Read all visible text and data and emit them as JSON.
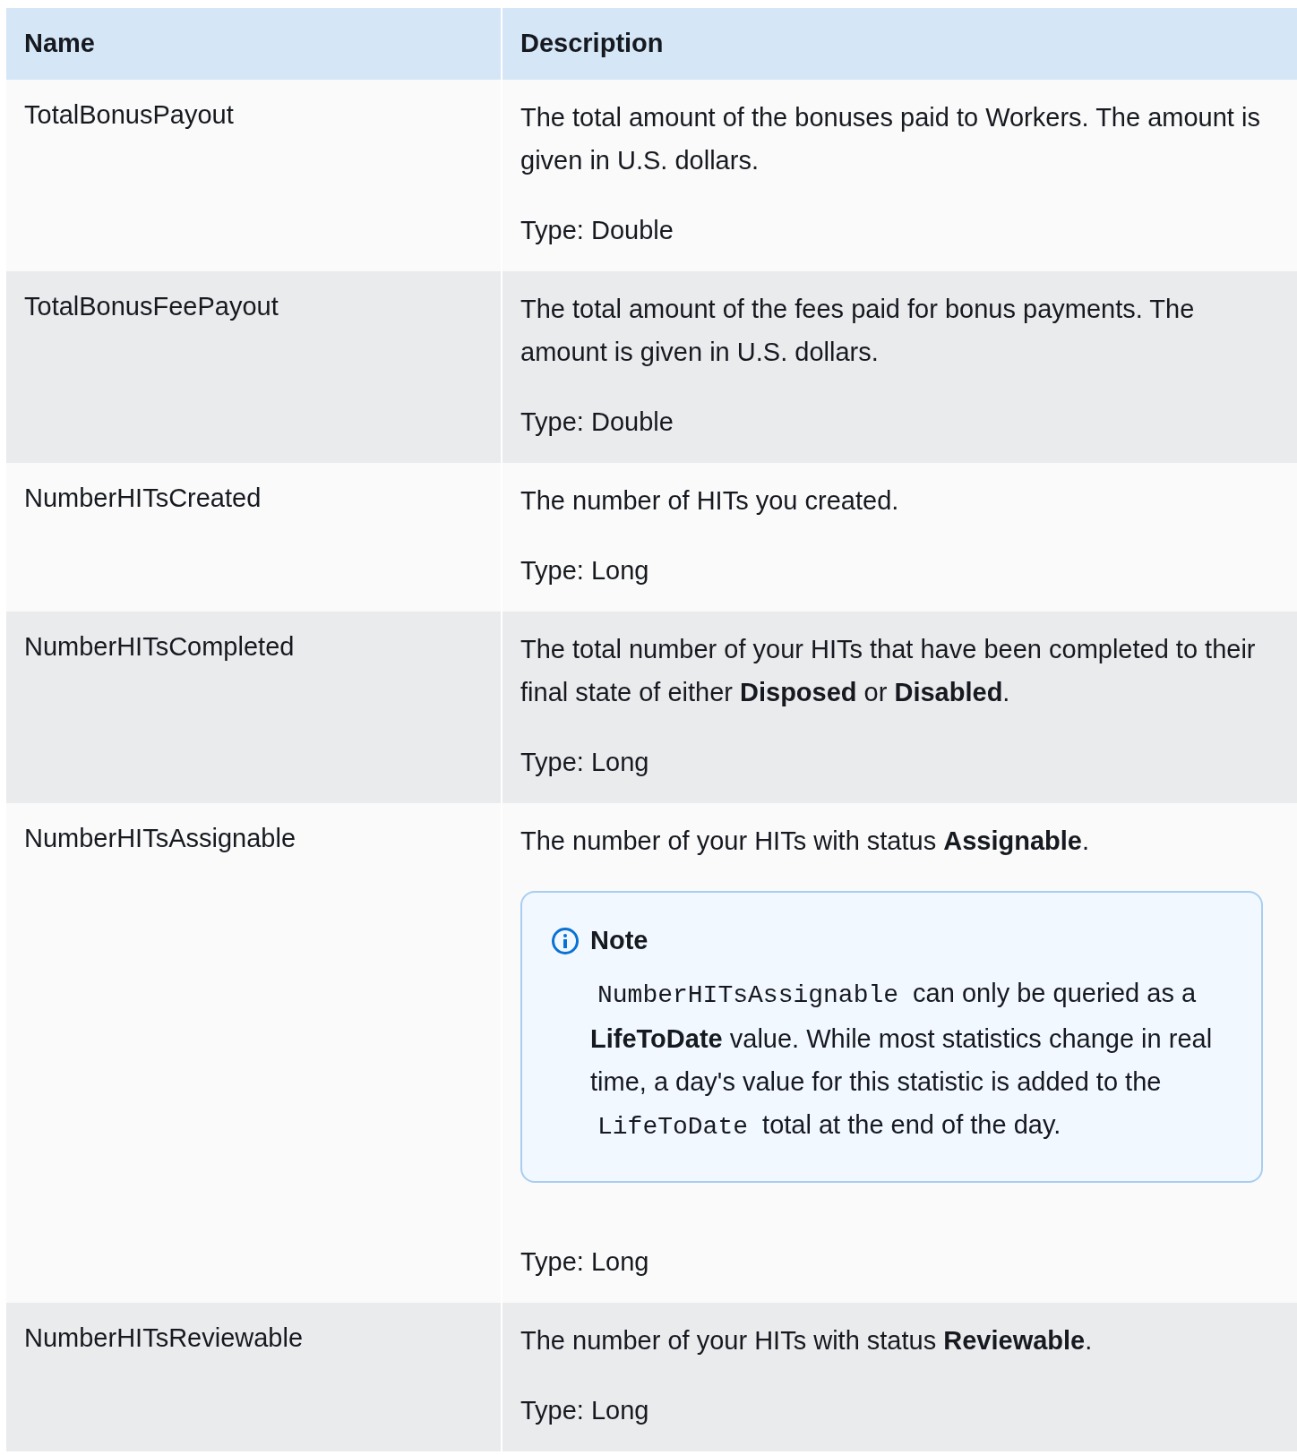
{
  "table": {
    "columns": [
      "Name",
      "Description"
    ],
    "rows": [
      {
        "name": "TotalBonusPayout",
        "description": [
          "The total amount of the bonuses paid to Workers. The amount is  given in U.S. dollars.",
          "Type: Double"
        ]
      },
      {
        "name": "TotalBonusFeePayout",
        "description": [
          "The total amount of the fees paid for bonus payments. The  amount is given in U.S. dollars.",
          "Type: Double"
        ]
      },
      {
        "name": "NumberHITsCreated",
        "description": [
          "The number of HITs you created.",
          "Type: Long"
        ]
      },
      {
        "name": "NumberHITsCompleted",
        "description": [
          "The total number of your HITs that have been completed to their  final state of either **Disposed** or **Disabled**.",
          "Type: Long"
        ]
      },
      {
        "name": "NumberHITsAssignable",
        "description": [
          "The number of your HITs with status **Assignable**.",
          "Type: Long"
        ],
        "note": {
          "title": "Note",
          "segments": [
            {
              "kind": "code",
              "text": "NumberHITsAssignable"
            },
            {
              "kind": "text",
              "text": " can only be queried as a **LifeToDate** value. While most  statistics change in real time, a day's value for this statistic  is added to the "
            },
            {
              "kind": "code",
              "text": "LifeToDate"
            },
            {
              "kind": "text",
              "text": " total at the  end of the day."
            }
          ]
        }
      },
      {
        "name": "NumberHITsReviewable",
        "description": [
          "The number of your HITs with status **Reviewable**.",
          "Type: Long"
        ]
      }
    ]
  }
}
